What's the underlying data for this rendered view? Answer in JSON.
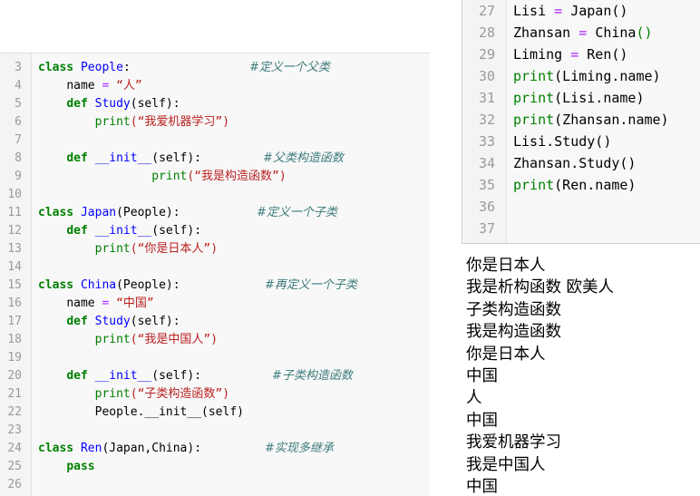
{
  "editor_left": {
    "lines": [
      {
        "num": "3",
        "indent": "",
        "tokens": [
          {
            "t": "class ",
            "c": "kw"
          },
          {
            "t": "People",
            "c": "cls"
          },
          {
            "t": ":",
            "c": ""
          }
        ],
        "comment": "#定义一个父类",
        "comment_col": 275
      },
      {
        "num": "4",
        "indent": "    ",
        "tokens": [
          {
            "t": "name ",
            "c": ""
          },
          {
            "t": "= ",
            "c": "op"
          },
          {
            "t": "“人”",
            "c": "str"
          }
        ],
        "comment": "",
        "comment_col": 0
      },
      {
        "num": "5",
        "indent": "    ",
        "tokens": [
          {
            "t": "def ",
            "c": "kw"
          },
          {
            "t": "Study",
            "c": "cls"
          },
          {
            "t": "(self):",
            "c": ""
          }
        ],
        "comment": "",
        "comment_col": 0
      },
      {
        "num": "6",
        "indent": "        ",
        "tokens": [
          {
            "t": "print",
            "c": "bi"
          },
          {
            "t": "(“我爱机器学习”)",
            "c": "str"
          }
        ],
        "comment": "",
        "comment_col": 0
      },
      {
        "num": "7",
        "indent": "",
        "tokens": [],
        "comment": "",
        "comment_col": 0
      },
      {
        "num": "8",
        "indent": "    ",
        "tokens": [
          {
            "t": "def ",
            "c": "kw"
          },
          {
            "t": "__init__",
            "c": "cls"
          },
          {
            "t": "(self):",
            "c": ""
          }
        ],
        "comment": "#父类构造函数",
        "comment_col": 290
      },
      {
        "num": "9",
        "indent": "                ",
        "tokens": [
          {
            "t": "print",
            "c": "bi"
          },
          {
            "t": "(“我是构造函数”)",
            "c": "str"
          }
        ],
        "comment": "",
        "comment_col": 0
      },
      {
        "num": "10",
        "indent": "",
        "tokens": [],
        "comment": "",
        "comment_col": 0
      },
      {
        "num": "11",
        "indent": "",
        "tokens": [
          {
            "t": "class ",
            "c": "kw"
          },
          {
            "t": "Japan",
            "c": "cls"
          },
          {
            "t": "(People):",
            "c": ""
          }
        ],
        "comment": "#定义一个子类",
        "comment_col": 283
      },
      {
        "num": "12",
        "indent": "    ",
        "tokens": [
          {
            "t": "def ",
            "c": "kw"
          },
          {
            "t": "__init__",
            "c": "cls"
          },
          {
            "t": "(self):",
            "c": ""
          }
        ],
        "comment": "",
        "comment_col": 0
      },
      {
        "num": "13",
        "indent": "        ",
        "tokens": [
          {
            "t": "print",
            "c": "bi"
          },
          {
            "t": "(“你是日本人”)",
            "c": "str"
          }
        ],
        "comment": "",
        "comment_col": 0
      },
      {
        "num": "14",
        "indent": "",
        "tokens": [],
        "comment": "",
        "comment_col": 0
      },
      {
        "num": "15",
        "indent": "",
        "tokens": [
          {
            "t": "class ",
            "c": "kw"
          },
          {
            "t": "China",
            "c": "cls"
          },
          {
            "t": "(People):",
            "c": ""
          }
        ],
        "comment": "#再定义一个子类",
        "comment_col": 292
      },
      {
        "num": "16",
        "indent": "    ",
        "tokens": [
          {
            "t": "name ",
            "c": ""
          },
          {
            "t": "= ",
            "c": "op"
          },
          {
            "t": "“中国”",
            "c": "str"
          }
        ],
        "comment": "",
        "comment_col": 0
      },
      {
        "num": "17",
        "indent": "    ",
        "tokens": [
          {
            "t": "def ",
            "c": "kw"
          },
          {
            "t": "Study",
            "c": "cls"
          },
          {
            "t": "(self):",
            "c": ""
          }
        ],
        "comment": "",
        "comment_col": 0
      },
      {
        "num": "18",
        "indent": "        ",
        "tokens": [
          {
            "t": "print",
            "c": "bi"
          },
          {
            "t": "(“我是中国人”)",
            "c": "str"
          }
        ],
        "comment": "",
        "comment_col": 0
      },
      {
        "num": "19",
        "indent": "",
        "tokens": [],
        "comment": "",
        "comment_col": 0
      },
      {
        "num": "20",
        "indent": "    ",
        "tokens": [
          {
            "t": "def ",
            "c": "kw"
          },
          {
            "t": "__init__",
            "c": "cls"
          },
          {
            "t": "(self):",
            "c": ""
          }
        ],
        "comment": "#子类构造函数",
        "comment_col": 300
      },
      {
        "num": "21",
        "indent": "        ",
        "tokens": [
          {
            "t": "print",
            "c": "bi"
          },
          {
            "t": "(“子类构造函数”)",
            "c": "str"
          }
        ],
        "comment": "",
        "comment_col": 0
      },
      {
        "num": "22",
        "indent": "        ",
        "tokens": [
          {
            "t": "People.__init__(self)",
            "c": ""
          }
        ],
        "comment": "",
        "comment_col": 0
      },
      {
        "num": "23",
        "indent": "",
        "tokens": [],
        "comment": "",
        "comment_col": 0
      },
      {
        "num": "24",
        "indent": "",
        "tokens": [
          {
            "t": "class ",
            "c": "kw"
          },
          {
            "t": "Ren",
            "c": "cls"
          },
          {
            "t": "(Japan,China):",
            "c": ""
          }
        ],
        "comment": "#实现多继承",
        "comment_col": 292
      },
      {
        "num": "25",
        "indent": "    ",
        "tokens": [
          {
            "t": "pass",
            "c": "kw"
          }
        ],
        "comment": "",
        "comment_col": 0
      },
      {
        "num": "26",
        "indent": "",
        "tokens": [],
        "comment": "",
        "comment_col": 0
      }
    ]
  },
  "editor_right": {
    "lines": [
      {
        "num": "27",
        "tokens": [
          {
            "t": "Lisi ",
            "c": ""
          },
          {
            "t": "= ",
            "c": "op"
          },
          {
            "t": "Japan()",
            "c": ""
          }
        ]
      },
      {
        "num": "28",
        "tokens": [
          {
            "t": "Zhansan ",
            "c": ""
          },
          {
            "t": "= ",
            "c": "op"
          },
          {
            "t": "China",
            "c": ""
          },
          {
            "t": "()",
            "c": "bi"
          }
        ]
      },
      {
        "num": "29",
        "tokens": [
          {
            "t": "Liming ",
            "c": ""
          },
          {
            "t": "= ",
            "c": "op"
          },
          {
            "t": "Ren()",
            "c": ""
          }
        ]
      },
      {
        "num": "30",
        "tokens": [
          {
            "t": "print",
            "c": "bi"
          },
          {
            "t": "(Liming.name)",
            "c": ""
          }
        ]
      },
      {
        "num": "31",
        "tokens": [
          {
            "t": "print",
            "c": "bi"
          },
          {
            "t": "(Lisi.name)",
            "c": ""
          }
        ]
      },
      {
        "num": "32",
        "tokens": [
          {
            "t": "print",
            "c": "bi"
          },
          {
            "t": "(Zhansan.name)",
            "c": ""
          }
        ]
      },
      {
        "num": "33",
        "tokens": [
          {
            "t": "Lisi.Study()",
            "c": ""
          }
        ]
      },
      {
        "num": "34",
        "tokens": [
          {
            "t": "Zhansan.Study()",
            "c": ""
          }
        ]
      },
      {
        "num": "35",
        "tokens": [
          {
            "t": "print",
            "c": "bi"
          },
          {
            "t": "(Ren.name)",
            "c": ""
          }
        ]
      },
      {
        "num": "36",
        "tokens": []
      },
      {
        "num": "37",
        "tokens": []
      }
    ]
  },
  "output": {
    "lines": [
      "你是日本人",
      "我是析构函数 欧美人",
      "子类构造函数",
      "我是构造函数",
      "你是日本人",
      "中国",
      "人",
      "中国",
      "我爱机器学习",
      "我是中国人",
      "中国"
    ]
  }
}
